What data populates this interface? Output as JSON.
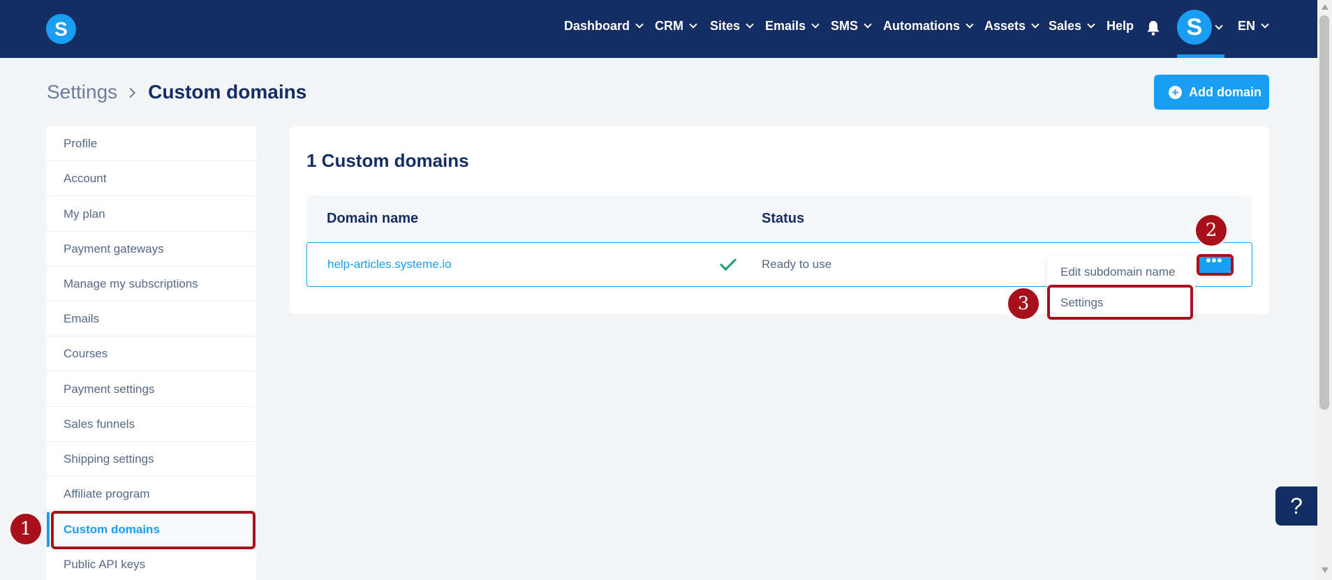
{
  "nav": {
    "items": [
      "Dashboard",
      "CRM",
      "Sites",
      "Emails",
      "SMS",
      "Automations",
      "Assets",
      "Sales"
    ],
    "help": "Help",
    "avatar_letter": "S",
    "language": "EN",
    "logo_letter": "S"
  },
  "header": {
    "breadcrumb_parent": "Settings",
    "breadcrumb_current": "Custom domains",
    "add_button": "Add domain"
  },
  "sidebar": {
    "items": [
      "Profile",
      "Account",
      "My plan",
      "Payment gateways",
      "Manage my subscriptions",
      "Emails",
      "Courses",
      "Payment settings",
      "Sales funnels",
      "Shipping settings",
      "Affiliate program",
      "Custom domains",
      "Public API keys"
    ],
    "active": "Custom domains"
  },
  "main": {
    "title": "1 Custom domains",
    "columns": [
      "Domain name",
      "Status"
    ],
    "rows": [
      {
        "domain": "help-articles.systeme.io",
        "status": "Ready to use"
      }
    ],
    "actions_label": "•••",
    "menu": [
      "Edit subdomain name",
      "Settings"
    ]
  },
  "annotations": [
    "1",
    "2",
    "3"
  ],
  "help_label": "?",
  "colors": {
    "navy": "#142d63",
    "accent": "#1a9ef3",
    "annotation": "#a8111b",
    "success": "#1b9e6b"
  }
}
